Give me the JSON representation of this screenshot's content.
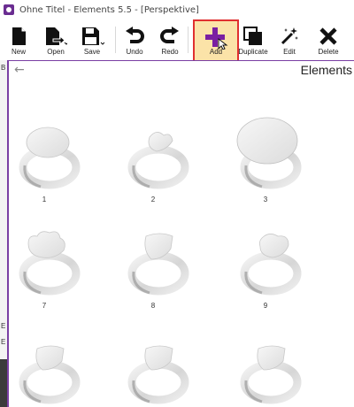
{
  "window": {
    "title": "Ohne Titel - Elements 5.5 - [Perspektive]"
  },
  "toolbar": {
    "new_label": "New",
    "open_label": "Open",
    "save_label": "Save",
    "undo_label": "Undo",
    "redo_label": "Redo",
    "add_label": "Add",
    "duplicate_label": "Duplicate",
    "edit_label": "Edit",
    "delete_label": "Delete"
  },
  "panel": {
    "title": "Elements",
    "back_icon": "arrow-left-icon"
  },
  "left_strip": {
    "marks": [
      "B",
      "E",
      "E"
    ]
  },
  "rings": [
    {
      "label": "1",
      "style": "oval-flat"
    },
    {
      "label": "2",
      "style": "small-heart"
    },
    {
      "label": "3",
      "style": "round-large"
    },
    {
      "label": "7",
      "style": "flower"
    },
    {
      "label": "8",
      "style": "shield"
    },
    {
      "label": "9",
      "style": "cushion"
    },
    {
      "label": "",
      "style": "shield-low"
    },
    {
      "label": "",
      "style": "shield-low"
    },
    {
      "label": "",
      "style": "shield-low"
    }
  ],
  "colors": {
    "accent": "#6a2d91",
    "highlight_border": "#e03030",
    "highlight_fill": "#fbe3a8"
  }
}
